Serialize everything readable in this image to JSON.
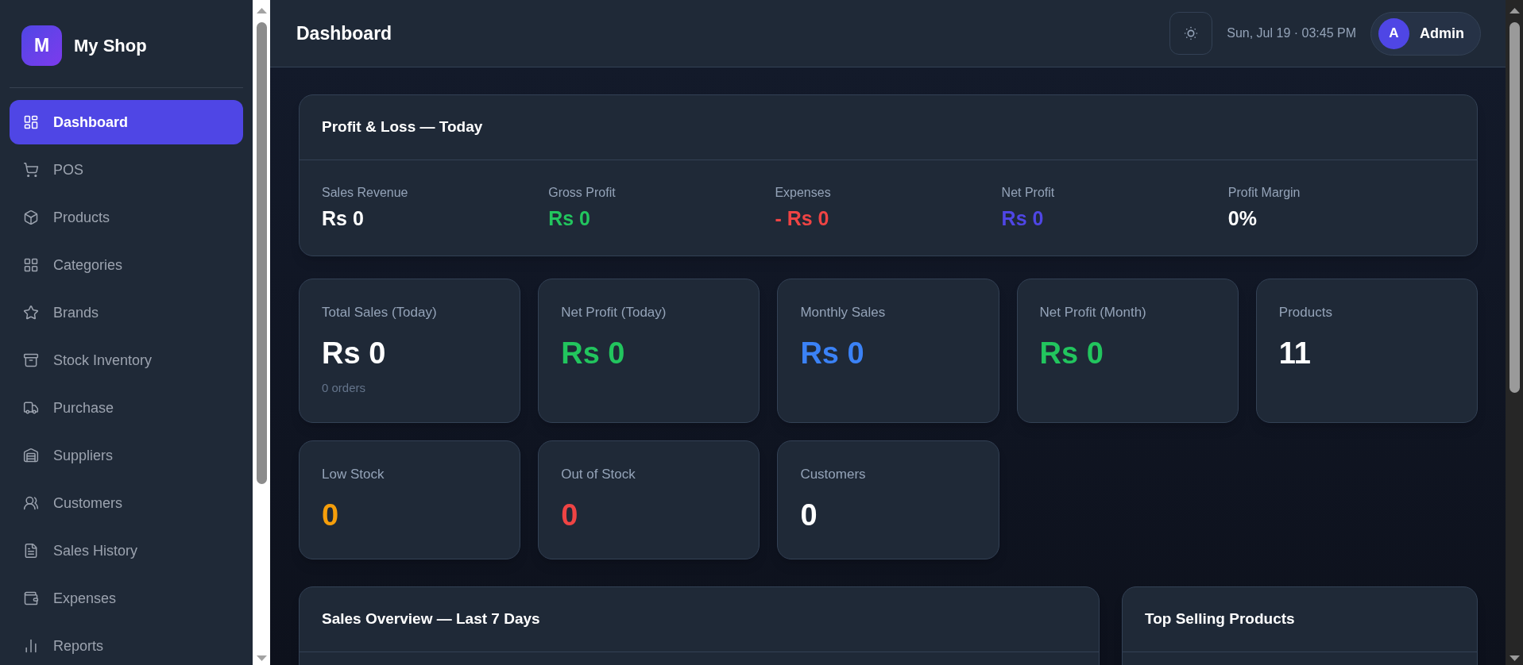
{
  "sidebar": {
    "logo_letter": "M",
    "shop_name": "My Shop",
    "items": [
      {
        "label": "Dashboard",
        "selected": true
      },
      {
        "label": "POS",
        "selected": false
      },
      {
        "label": "Products",
        "selected": false
      },
      {
        "label": "Categories",
        "selected": false
      },
      {
        "label": "Brands",
        "selected": false
      },
      {
        "label": "Stock Inventory",
        "selected": false
      },
      {
        "label": "Purchase",
        "selected": false
      },
      {
        "label": "Suppliers",
        "selected": false
      },
      {
        "label": "Customers",
        "selected": false
      },
      {
        "label": "Sales History",
        "selected": false
      },
      {
        "label": "Expenses",
        "selected": false
      },
      {
        "label": "Reports",
        "selected": false
      }
    ]
  },
  "header": {
    "title": "Dashboard",
    "datetime": "Sun, Jul 19 · 03:45 PM",
    "user": {
      "initial": "A",
      "name": "Admin"
    }
  },
  "profit_loss": {
    "title": "Profit & Loss — Today",
    "metrics": [
      {
        "label": "Sales Revenue",
        "value": "Rs 0",
        "color": "#ffffff"
      },
      {
        "label": "Gross Profit",
        "value": "Rs 0",
        "color": "#22c55e"
      },
      {
        "label": "Expenses",
        "value": "- Rs 0",
        "color": "#ef4444"
      },
      {
        "label": "Net Profit",
        "value": "Rs 0",
        "color": "#4f46e5"
      },
      {
        "label": "Profit Margin",
        "value": "0%",
        "color": "#ffffff"
      }
    ]
  },
  "stats": [
    {
      "label": "Total Sales (Today)",
      "value": "Rs 0",
      "note": "0 orders",
      "color": "#ffffff"
    },
    {
      "label": "Net Profit (Today)",
      "value": "Rs 0",
      "color": "#22c55e"
    },
    {
      "label": "Monthly Sales",
      "value": "Rs 0",
      "color": "#3b82f6"
    },
    {
      "label": "Net Profit (Month)",
      "value": "Rs 0",
      "color": "#22c55e"
    },
    {
      "label": "Products",
      "value": "11",
      "color": "#ffffff"
    },
    {
      "label": "Low Stock",
      "value": "0",
      "color": "#f59e0b"
    },
    {
      "label": "Out of Stock",
      "value": "0",
      "color": "#ef4444"
    },
    {
      "label": "Customers",
      "value": "0",
      "color": "#ffffff"
    }
  ],
  "panels": [
    {
      "title": "Sales Overview — Last 7 Days"
    },
    {
      "title": "Top Selling Products"
    }
  ]
}
